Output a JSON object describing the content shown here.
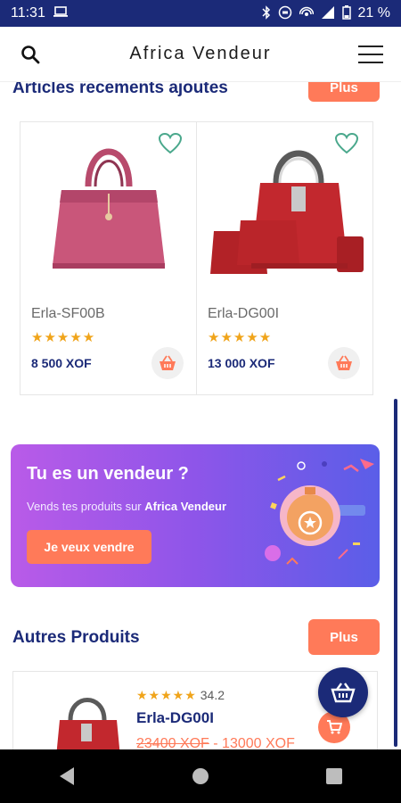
{
  "statusbar": {
    "time": "11:31",
    "battery": "21 %"
  },
  "header": {
    "title": "Africa Vendeur"
  },
  "section_recent": {
    "title": "Articles recements ajoutes",
    "more": "Plus"
  },
  "products": [
    {
      "name": "Erla-SF00B",
      "stars": "★★★★★",
      "price": "8 500 XOF"
    },
    {
      "name": "Erla-DG00I",
      "stars": "★★★★★",
      "price": "13 000 XOF"
    }
  ],
  "promo": {
    "title": "Tu es un vendeur ?",
    "subtitle_prefix": "Vends tes produits sur ",
    "subtitle_brand": "Africa Vendeur",
    "button": "Je veux vendre"
  },
  "section_other": {
    "title": "Autres Produits",
    "more": "Plus"
  },
  "other_product": {
    "stars": "★★★★★",
    "rating": "34.2",
    "name": "Erla-DG00I",
    "old_price": "23400 XOF",
    "separator": " - ",
    "price": "13000 XOF"
  },
  "colors": {
    "primary": "#1b2a78",
    "accent": "#ff7a59",
    "star": "#f0a41a"
  }
}
